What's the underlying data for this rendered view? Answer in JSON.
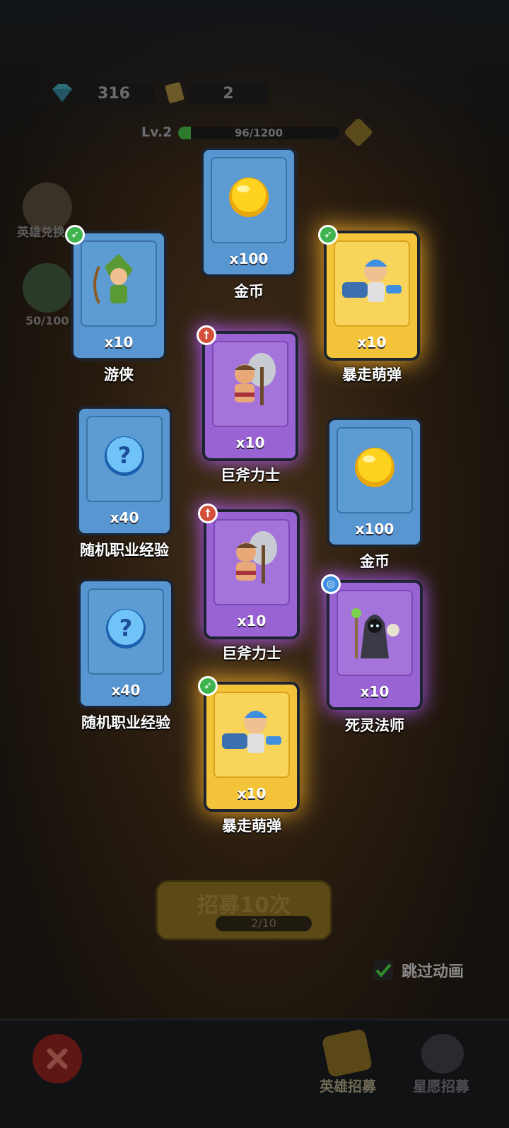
{
  "resources": {
    "gems": "316",
    "tickets": "2"
  },
  "level": {
    "label": "Lv.2",
    "xp_text": "96/1200",
    "xp_fraction": 0.08
  },
  "side": {
    "hero_exchange": "英雄兑换",
    "star_progress": "50/100"
  },
  "cards": [
    {
      "name": "游侠",
      "count": "x10",
      "rarity": "blue",
      "class": "ranger",
      "icon": "ranger-icon"
    },
    {
      "name": "金币",
      "count": "x100",
      "rarity": "blue",
      "class": "",
      "icon": "gold-coin-icon"
    },
    {
      "name": "暴走萌弹",
      "count": "x10",
      "rarity": "gold",
      "class": "ranger",
      "icon": "cannon-hero-icon"
    },
    {
      "name": "巨斧力士",
      "count": "x10",
      "rarity": "purple",
      "class": "warrior",
      "icon": "axe-warrior-icon"
    },
    {
      "name": "随机职业经验",
      "count": "x40",
      "rarity": "blue",
      "class": "",
      "icon": "question-orb-icon"
    },
    {
      "name": "金币",
      "count": "x100",
      "rarity": "blue",
      "class": "",
      "icon": "gold-coin-icon"
    },
    {
      "name": "巨斧力士",
      "count": "x10",
      "rarity": "purple",
      "class": "warrior",
      "icon": "axe-warrior-icon"
    },
    {
      "name": "随机职业经验",
      "count": "x40",
      "rarity": "blue",
      "class": "",
      "icon": "question-orb-icon"
    },
    {
      "name": "死灵法师",
      "count": "x10",
      "rarity": "purple",
      "class": "mage",
      "icon": "necromancer-icon"
    },
    {
      "name": "暴走萌弹",
      "count": "x10",
      "rarity": "gold",
      "class": "ranger",
      "icon": "cannon-hero-icon"
    }
  ],
  "recruit": {
    "label": "招募10次",
    "progress": "2/10"
  },
  "skip": {
    "label": "跳过动画",
    "checked": true
  },
  "tabs": {
    "hero": "英雄招募",
    "wish": "星愿招募"
  },
  "colors": {
    "blue_card": "#5796d0",
    "purple_card": "#9a63d4",
    "gold_card": "#f3c43a"
  }
}
